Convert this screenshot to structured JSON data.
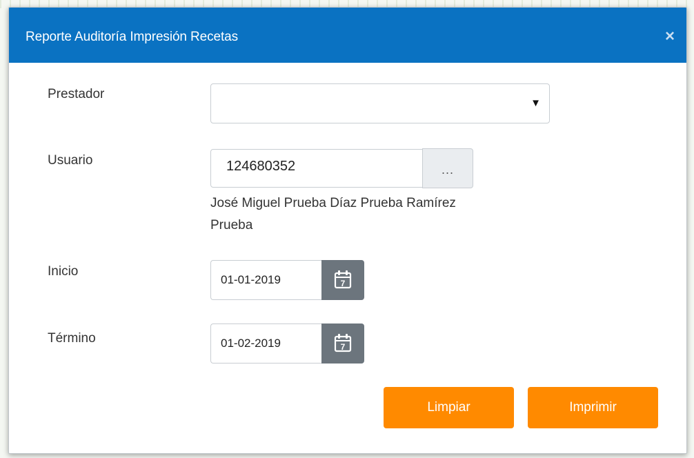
{
  "dialog": {
    "title": "Reporte Auditoría Impresión Recetas",
    "close_glyph": "×"
  },
  "form": {
    "prestador": {
      "label": "Prestador",
      "value": "",
      "arrow_glyph": "▼"
    },
    "usuario": {
      "label": "Usuario",
      "value": "124680352",
      "lookup_label": "...",
      "name_line1": "José Miguel Prueba Díaz Prueba Ramírez",
      "name_line2": "Prueba"
    },
    "inicio": {
      "label": "Inicio",
      "value": "01-01-2019",
      "calendar_day": "7"
    },
    "termino": {
      "label": "Término",
      "value": "01-02-2019",
      "calendar_day": "7"
    }
  },
  "actions": {
    "clear_label": "Limpiar",
    "print_label": "Imprimir"
  },
  "colors": {
    "header": "#0a72c2",
    "primary_button": "#ff8a00",
    "calendar_button": "#6c757d"
  },
  "icons": {
    "close": "close-icon",
    "dropdown": "chevron-down-icon",
    "calendar": "calendar-icon"
  }
}
